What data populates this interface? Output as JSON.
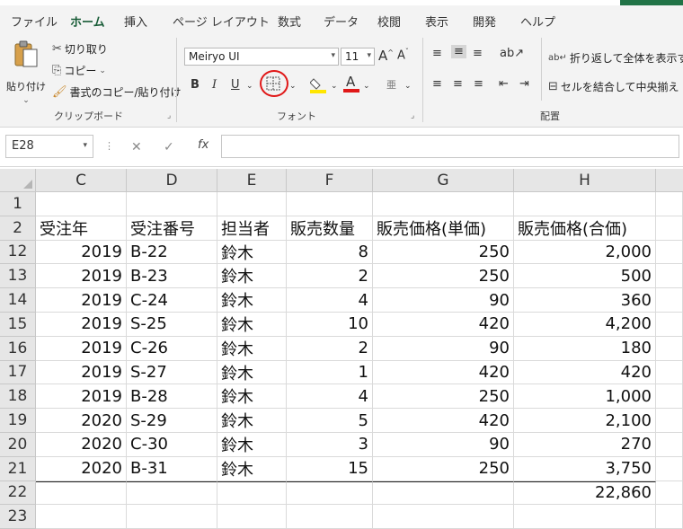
{
  "tabs": [
    "ファイル",
    "ホーム",
    "挿入",
    "ページ レイアウト",
    "数式",
    "データ",
    "校閲",
    "表示",
    "開発",
    "ヘルプ"
  ],
  "active_tab": "ホーム",
  "clipboard": {
    "paste_label": "貼り付け",
    "cut_label": "切り取り",
    "copy_label": "コピー",
    "format_painter_label": "書式のコピー/貼り付け",
    "group_label": "クリップボード"
  },
  "font": {
    "font_name": "Meiryo UI",
    "font_size": "11",
    "group_label": "フォント",
    "bold": "B",
    "italic": "I",
    "underline": "U"
  },
  "alignment": {
    "wrap_text_label": "折り返して全体を表示する",
    "merge_center_label": "セルを結合して中央揃え",
    "group_label": "配置"
  },
  "formula_bar": {
    "name_box": "E28",
    "formula": ""
  },
  "columns": [
    "C",
    "D",
    "E",
    "F",
    "G",
    "H"
  ],
  "rows": [
    {
      "num": "1",
      "cells": [
        "",
        "",
        "",
        "",
        "",
        ""
      ]
    },
    {
      "num": "2",
      "cells": [
        "受注年",
        "受注番号",
        "担当者",
        "販売数量",
        "販売価格(単価)",
        "販売価格(合価)"
      ]
    },
    {
      "num": "12",
      "cells": [
        "2019",
        "B-22",
        "鈴木",
        "8",
        "250",
        "2,000"
      ]
    },
    {
      "num": "13",
      "cells": [
        "2019",
        "B-23",
        "鈴木",
        "2",
        "250",
        "500"
      ]
    },
    {
      "num": "14",
      "cells": [
        "2019",
        "C-24",
        "鈴木",
        "4",
        "90",
        "360"
      ]
    },
    {
      "num": "15",
      "cells": [
        "2019",
        "S-25",
        "鈴木",
        "10",
        "420",
        "4,200"
      ]
    },
    {
      "num": "16",
      "cells": [
        "2019",
        "C-26",
        "鈴木",
        "2",
        "90",
        "180"
      ]
    },
    {
      "num": "17",
      "cells": [
        "2019",
        "S-27",
        "鈴木",
        "1",
        "420",
        "420"
      ]
    },
    {
      "num": "18",
      "cells": [
        "2019",
        "B-28",
        "鈴木",
        "4",
        "250",
        "1,000"
      ]
    },
    {
      "num": "19",
      "cells": [
        "2020",
        "S-29",
        "鈴木",
        "5",
        "420",
        "2,100"
      ]
    },
    {
      "num": "20",
      "cells": [
        "2020",
        "C-30",
        "鈴木",
        "3",
        "90",
        "270"
      ]
    },
    {
      "num": "21",
      "cells": [
        "2020",
        "B-31",
        "鈴木",
        "15",
        "250",
        "3,750"
      ]
    },
    {
      "num": "22",
      "cells": [
        "",
        "",
        "",
        "",
        "",
        "22,860"
      ]
    },
    {
      "num": "23",
      "cells": [
        "",
        "",
        "",
        "",
        "",
        ""
      ]
    }
  ],
  "colors": {
    "accent": "#185c37",
    "highlight_red": "#e01818",
    "fill_yellow": "#ffe600",
    "font_red": "#e01818"
  }
}
